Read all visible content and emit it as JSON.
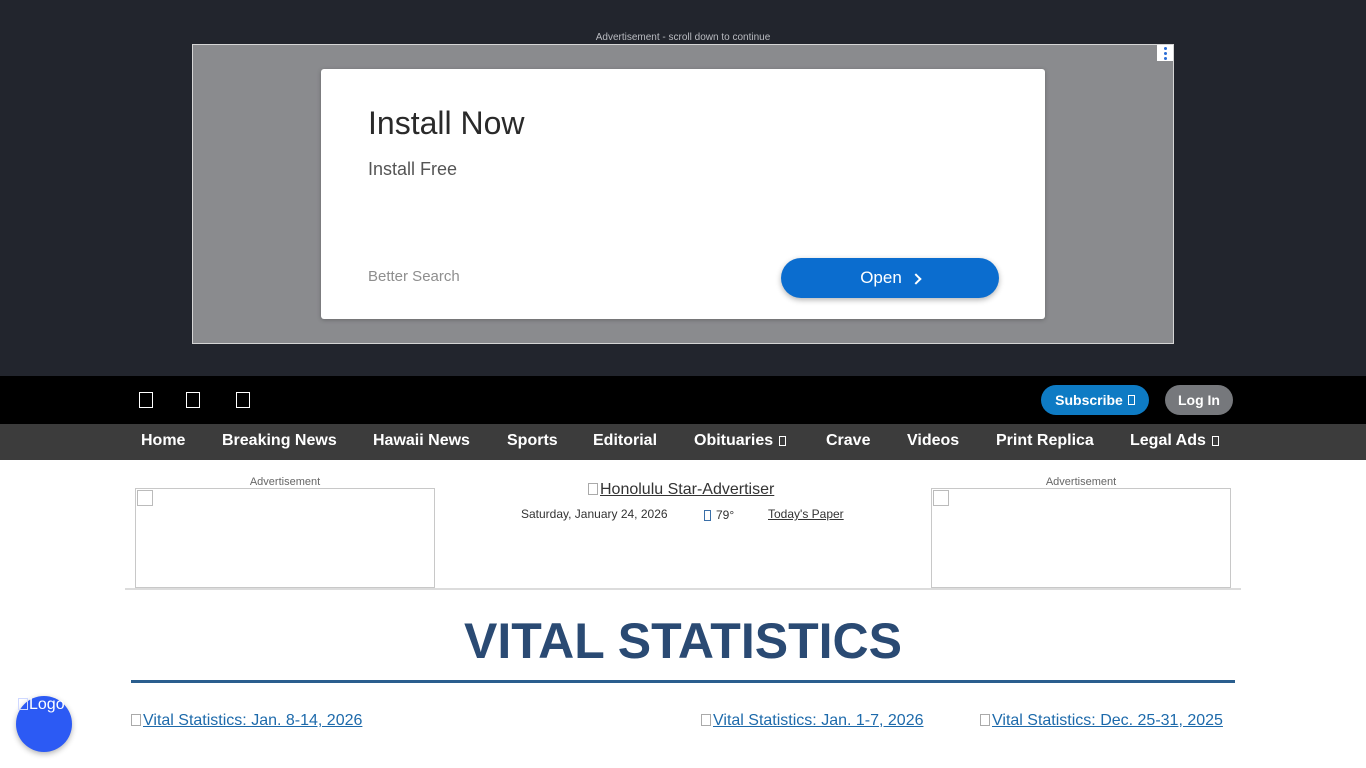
{
  "ad_top": {
    "caption": "Advertisement - scroll down to continue",
    "title": "Install Now",
    "subtitle": "Install Free",
    "brand": "Better Search",
    "button_label": "Open"
  },
  "topbar": {
    "social_icons": [
      "facebook-icon",
      "twitter-icon",
      "instagram-icon"
    ],
    "subscribe_label": "Subscribe",
    "login_label": "Log In"
  },
  "nav": {
    "items": [
      {
        "label": "Home"
      },
      {
        "label": "Breaking News"
      },
      {
        "label": "Hawaii News"
      },
      {
        "label": "Sports"
      },
      {
        "label": "Editorial"
      },
      {
        "label": "Obituaries"
      },
      {
        "label": "Crave"
      },
      {
        "label": "Videos"
      },
      {
        "label": "Print Replica"
      },
      {
        "label": "Legal Ads"
      }
    ]
  },
  "header": {
    "ad_left_label": "Advertisement",
    "ad_right_label": "Advertisement",
    "logo_alt": "Honolulu Star-Advertiser",
    "date": "Saturday, January 24, 2026",
    "temperature": "79°",
    "todays_paper": "Today's Paper"
  },
  "main": {
    "title": "VITAL STATISTICS",
    "links": [
      {
        "label": "Vital Statistics: Jan. 8-14, 2026"
      },
      {
        "label": "Vital Statistics: Jan. 1-7, 2026"
      },
      {
        "label": "Vital Statistics: Dec. 25-31, 2025"
      }
    ]
  },
  "chat": {
    "logo_alt": "Logo"
  },
  "colors": {
    "nav_bg": "#3c3c3c",
    "title": "#2a4a73",
    "subscribe": "#0e7bc4",
    "ad_button": "#0b6dcf",
    "chat_bubble": "#2c5af4"
  }
}
